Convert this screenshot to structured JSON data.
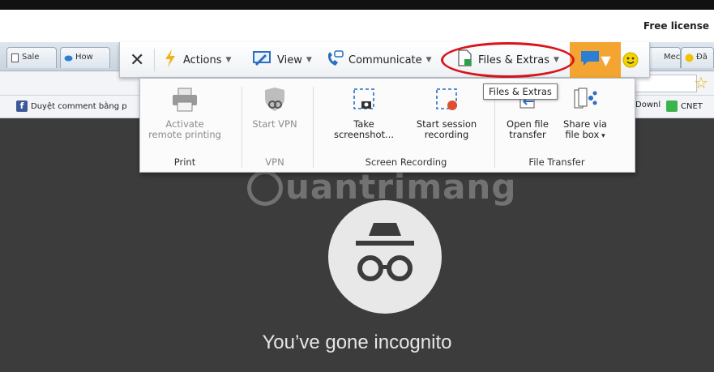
{
  "window": {
    "license_text": "Free license"
  },
  "browser_tabs": [
    {
      "label": "Sale"
    },
    {
      "label": "How"
    },
    {
      "label": "Mec"
    },
    {
      "label": "Đã"
    }
  ],
  "bookmarks": [
    {
      "label": "Duyệt comment bằng p"
    },
    {
      "label": "Downl"
    },
    {
      "label": "CNET"
    }
  ],
  "toolbar": {
    "actions_label": "Actions",
    "view_label": "View",
    "communicate_label": "Communicate",
    "files_extras_label": "Files & Extras"
  },
  "ribbon": {
    "buttons": {
      "remote_printing": "Activate remote printing",
      "start_vpn": "Start VPN",
      "take_screenshot": "Take screenshot...",
      "start_recording": "Start session recording",
      "open_file_transfer": "Open file transfer",
      "share_file_box": "Share via file box"
    },
    "groups": {
      "print": "Print",
      "vpn": "VPN",
      "screen_recording": "Screen Recording",
      "file_transfer": "File Transfer"
    }
  },
  "tooltip": "Files & Extras",
  "watermark": "uantrimang",
  "content": {
    "incognito_text": "You’ve gone incognito"
  },
  "colors": {
    "highlight": "#d8141c",
    "orange": "#f4a531",
    "record_dot": "#e0502e"
  }
}
